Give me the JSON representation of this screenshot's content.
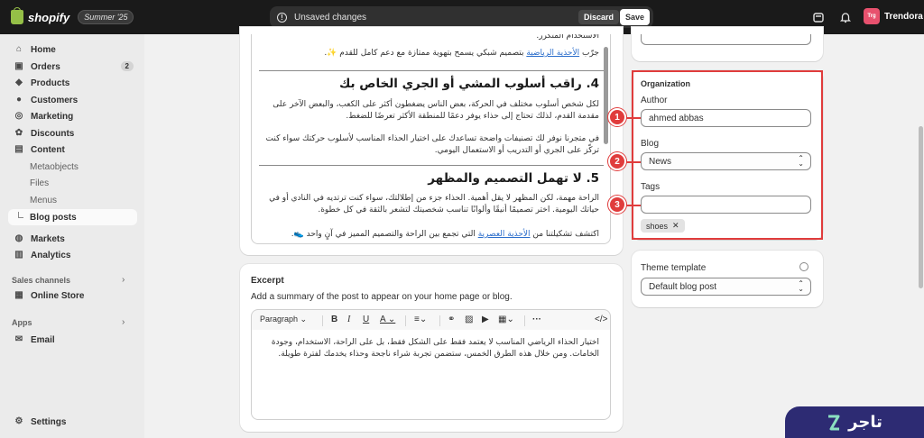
{
  "topbar": {
    "logo_text": "shopify",
    "edition": "Summer '25",
    "unsaved_text": "Unsaved changes",
    "discard_label": "Discard",
    "save_label": "Save",
    "store_initials": "Trg",
    "store_name": "Trendora"
  },
  "sidebar": {
    "items": [
      {
        "label": "Home",
        "icon": "home-icon"
      },
      {
        "label": "Orders",
        "icon": "orders-icon",
        "badge": "2"
      },
      {
        "label": "Products",
        "icon": "tag-icon"
      },
      {
        "label": "Customers",
        "icon": "person-icon"
      },
      {
        "label": "Marketing",
        "icon": "target-icon"
      },
      {
        "label": "Discounts",
        "icon": "discount-icon"
      },
      {
        "label": "Content",
        "icon": "content-icon"
      }
    ],
    "content_sub": [
      "Metaobjects",
      "Files",
      "Menus",
      "Blog posts"
    ],
    "items2": [
      {
        "label": "Markets",
        "icon": "globe-icon"
      },
      {
        "label": "Analytics",
        "icon": "chart-icon"
      }
    ],
    "sales_channels_label": "Sales channels",
    "online_store_label": "Online Store",
    "apps_label": "Apps",
    "email_label": "Email",
    "settings_label": "Settings"
  },
  "editor": {
    "line_top": "الاستخدام المتكرر.",
    "line_1_link": "الأحذية الرياضية",
    "line_1_pre": "جرّب ",
    "line_1_post": " بتصميم شبكي يسمح بتهوية ممتازة مع دعم كامل للقدم ✨.",
    "heading_4": "4. راقب أسلوب المشي أو الجري الخاص بك",
    "para_4a": "لكل شخص أسلوب مختلف في الحركة، بعض الناس يضغطون أكثر على الكعب، والبعض الآخر على مقدمة القدم، لذلك تحتاج إلى حذاء يوفر دعمًا للمنطقة الأكثر تعرضًا للضغط.",
    "para_4b": "في متجرنا نوفر لك تصنيفات واضحة تساعدك على اختيار الحذاء المناسب لأسلوب حركتك سواء كنت تركّز على الجري أو التدريب أو الاستعمال اليومي.",
    "heading_5": "5. لا تهمل التصميم والمظهر",
    "para_5a": "الراحة مهمة، لكن المظهر لا يقل أهمية. الحذاء جزء من إطلالتك، سواء كنت ترتديه في النادي أو في حياتك اليومية. اختر تصميمًا أنيقًا وألوانًا تناسب شخصيتك لتشعر بالثقة في كل خطوة.",
    "para_5b_pre": "اكتشف تشكيلتنا من ",
    "para_5b_link": "الأحذية العصرية",
    "para_5b_post": " التي تجمع بين الراحة والتصميم المميز في آنٍ واحد 👟."
  },
  "excerpt": {
    "title": "Excerpt",
    "description": "Add a summary of the post to appear on your home page or blog.",
    "paragraph_label": "Paragraph",
    "text": "اختيار الحذاء الرياضي المناسب لا يعتمد فقط على الشكل فقط، بل على الراحة، الاستخدام، وجودة الخامات. ومن خلال هذه الطرق الخمس، ستضمن تجربة شراء ناجحة وحذاء يخدمك لفترة طويلة."
  },
  "organization": {
    "title": "Organization",
    "author_label": "Author",
    "author_value": "ahmed abbas",
    "blog_label": "Blog",
    "blog_value": "News",
    "tags_label": "Tags",
    "tags_value": "",
    "tag_chip": "shoes",
    "markers": [
      "1",
      "2",
      "3"
    ]
  },
  "theme": {
    "title": "Theme template",
    "value": "Default blog post"
  },
  "watermark": {
    "text": "تاجر"
  },
  "colors": {
    "topbar": "#1a1a1a",
    "highlight": "#e03c3c",
    "watermark": "#2d2b73",
    "link": "#2c6ecb"
  }
}
